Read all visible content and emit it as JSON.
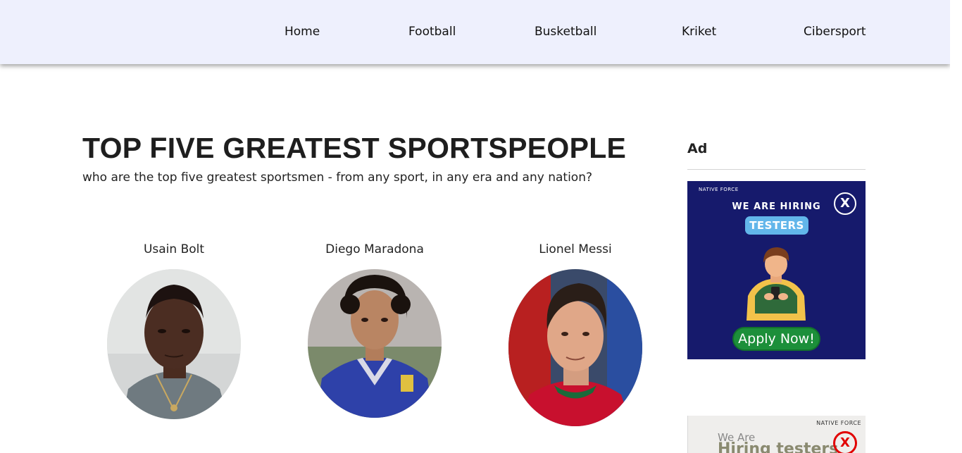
{
  "nav": {
    "items": [
      {
        "label": "Home"
      },
      {
        "label": "Football"
      },
      {
        "label": "Busketball"
      },
      {
        "label": "Kriket"
      },
      {
        "label": "Cibersport"
      }
    ]
  },
  "main": {
    "title": "TOP FIVE GREATEST SPORTSPEOPLE",
    "subtitle": "who are the top five greatest sportsmen - from any sport, in any era and any nation?",
    "athletes": [
      {
        "name": "Usain Bolt"
      },
      {
        "name": "Diego Maradona"
      },
      {
        "name": "Lionel Messi"
      }
    ]
  },
  "sidebar": {
    "ad_label": "Ad",
    "ad1": {
      "brand": "NATIVE FORCE",
      "close": "X",
      "headline": "WE ARE HIRING",
      "highlight": "TESTERS",
      "cta": "Apply Now!"
    },
    "ad2": {
      "brand": "NATIVE FORCE",
      "line1": "We Are",
      "line2": "Hiring testers",
      "close": "X"
    }
  },
  "colors": {
    "nav_bg": "#eef0fd",
    "ad1_bg": "#161a6c",
    "ad1_cta": "#1c8f3a",
    "ad1_pill": "#62b6ea",
    "ad2_close": "#e10000"
  }
}
